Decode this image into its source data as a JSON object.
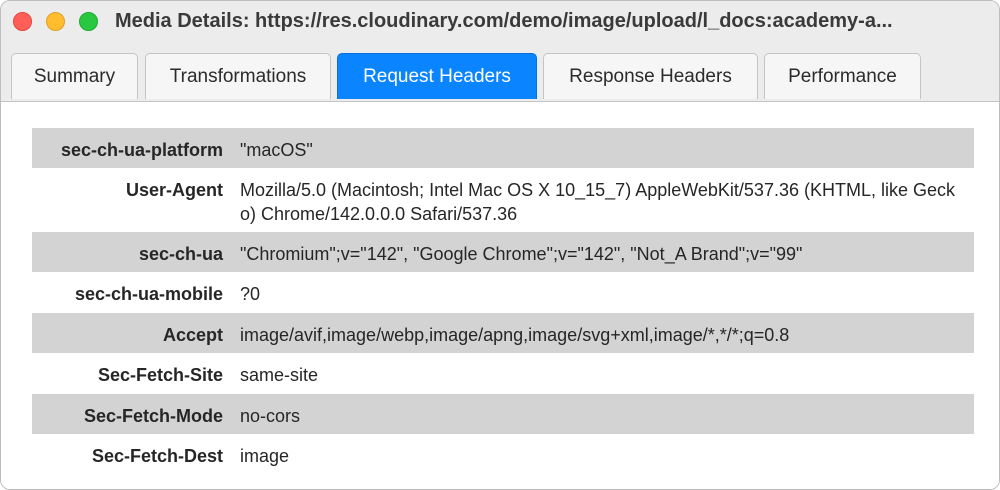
{
  "window": {
    "title": "Media Details: https://res.cloudinary.com/demo/image/upload/l_docs:academy-a..."
  },
  "tabs": [
    {
      "label": "Summary",
      "active": false
    },
    {
      "label": "Transformations",
      "active": false
    },
    {
      "label": "Request Headers",
      "active": true
    },
    {
      "label": "Response Headers",
      "active": false
    },
    {
      "label": "Performance",
      "active": false
    }
  ],
  "headers": [
    {
      "key": "sec-ch-ua-platform",
      "value": "\"macOS\""
    },
    {
      "key": "User-Agent",
      "value": "Mozilla/5.0 (Macintosh; Intel Mac OS X 10_15_7) AppleWebKit/537.36 (KHTML, like Gecko) Chrome/142.0.0.0 Safari/537.36"
    },
    {
      "key": "sec-ch-ua",
      "value": "\"Chromium\";v=\"142\", \"Google Chrome\";v=\"142\", \"Not_A Brand\";v=\"99\""
    },
    {
      "key": "sec-ch-ua-mobile",
      "value": "?0"
    },
    {
      "key": "Accept",
      "value": "image/avif,image/webp,image/apng,image/svg+xml,image/*,*/*;q=0.8"
    },
    {
      "key": "Sec-Fetch-Site",
      "value": "same-site"
    },
    {
      "key": "Sec-Fetch-Mode",
      "value": "no-cors"
    },
    {
      "key": "Sec-Fetch-Dest",
      "value": "image"
    }
  ],
  "colors": {
    "active_tab": "#0a84ff",
    "shaded_row": "#d3d3d3",
    "close": "#ff5f57",
    "minimize": "#febc2e",
    "maximize": "#28c840"
  }
}
